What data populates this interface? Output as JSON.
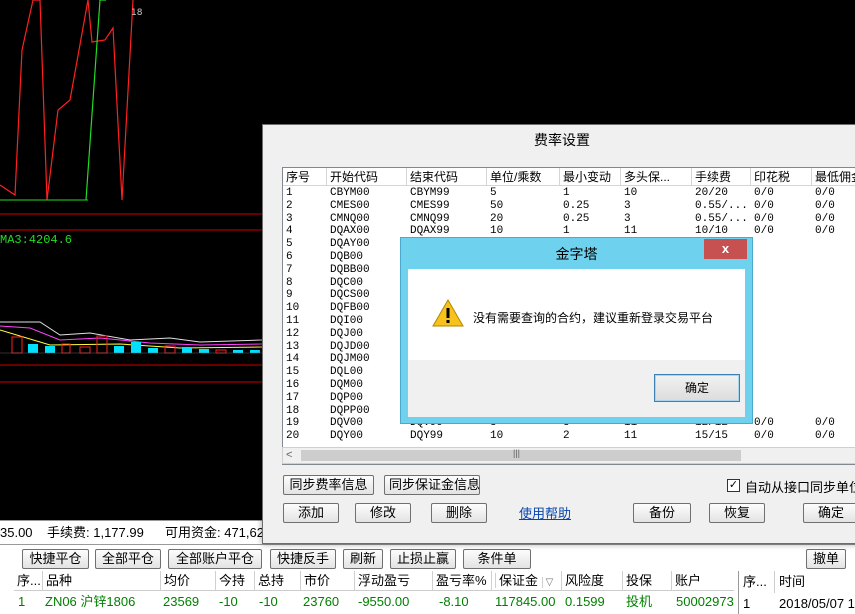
{
  "chart": {
    "ma_label": "MA3:4204.6",
    "tick_label": "18",
    "colors": {
      "red": "#ff2020",
      "green": "#22dd22",
      "cyan": "#00e0ff",
      "white": "#e0e0e0",
      "magenta": "#ff40ff"
    }
  },
  "status": {
    "balance_tail": "35.00",
    "fee": "手续费: 1,177.99",
    "available": "可用资金: 471,62"
  },
  "bottom_buttons": [
    "快捷平仓",
    "全部平仓",
    "全部账户平仓",
    "快捷反手",
    "刷新",
    "止损止赢",
    "条件单"
  ],
  "cancel_button": "撤单",
  "positions": {
    "headers": [
      "序...",
      "品种",
      "均价",
      "今持",
      "总持",
      "市价",
      "浮动盈亏",
      "盈亏率%",
      "保证金",
      "风险度",
      "投保",
      "账户"
    ],
    "sort_indicator": "▽",
    "rows": [
      [
        "1",
        "ZN06 沪锌1806",
        "23569",
        "-10",
        "-10",
        "23760",
        "-9550.00",
        "-8.10",
        "117845.00",
        "0.1599",
        "投机",
        "50002973"
      ]
    ]
  },
  "side_table": {
    "headers": [
      "序...",
      "时间"
    ],
    "row": [
      "1",
      "2018/05/07 1"
    ]
  },
  "fee_dialog": {
    "title": "费率设置",
    "columns": [
      "序号",
      "开始代码",
      "结束代码",
      "单位/乘数",
      "最小变动",
      "多头保...",
      "手续费",
      "印花税",
      "最低佣金"
    ],
    "rows": [
      [
        "1",
        "CBYM00",
        "CBYM99",
        "5",
        "1",
        "10",
        "20/20",
        "0/0",
        "0/0"
      ],
      [
        "2",
        "CMES00",
        "CMES99",
        "50",
        "0.25",
        "3",
        "0.55/...",
        "0/0",
        "0/0"
      ],
      [
        "3",
        "CMNQ00",
        "CMNQ99",
        "20",
        "0.25",
        "3",
        "0.55/...",
        "0/0",
        "0/0"
      ],
      [
        "4",
        "DQAX00",
        "DQAX99",
        "10",
        "1",
        "11",
        "10/10",
        "0/0",
        "0/0"
      ],
      [
        "5",
        "DQAY00",
        "",
        "",
        "",
        "",
        "",
        "",
        ""
      ],
      [
        "6",
        "DQB00",
        "",
        "",
        "",
        "",
        "",
        "",
        ""
      ],
      [
        "7",
        "DQBB00",
        "",
        "",
        "",
        "",
        "",
        "",
        ""
      ],
      [
        "8",
        "DQC00",
        "",
        "",
        "",
        "",
        "",
        "",
        ""
      ],
      [
        "9",
        "DQCS00",
        "",
        "",
        "",
        "",
        "",
        "",
        ""
      ],
      [
        "10",
        "DQFB00",
        "",
        "",
        "",
        "",
        "",
        "",
        ""
      ],
      [
        "11",
        "DQI00",
        "",
        "",
        "",
        "",
        "",
        "",
        ""
      ],
      [
        "12",
        "DQJ00",
        "",
        "",
        "",
        "",
        "",
        "",
        ""
      ],
      [
        "13",
        "DQJD00",
        "",
        "",
        "",
        "",
        "",
        "",
        ""
      ],
      [
        "14",
        "DQJM00",
        "",
        "",
        "",
        "",
        "",
        "",
        ""
      ],
      [
        "15",
        "DQL00",
        "",
        "",
        "",
        "",
        "",
        "",
        ""
      ],
      [
        "16",
        "DQM00",
        "",
        "",
        "",
        "",
        "",
        "",
        ""
      ],
      [
        "17",
        "DQP00",
        "",
        "",
        "",
        "",
        "",
        "",
        ""
      ],
      [
        "18",
        "DQPP00",
        "",
        "",
        "",
        "",
        "",
        "",
        ""
      ],
      [
        "19",
        "DQV00",
        "DQV99",
        "5",
        "5",
        "11",
        "12/12",
        "0/0",
        "0/0"
      ],
      [
        "20",
        "DQY00",
        "DQY99",
        "10",
        "2",
        "11",
        "15/15",
        "0/0",
        "0/0"
      ]
    ],
    "buttons": {
      "sync_rate": "同步费率信息",
      "sync_margin": "同步保证金信息",
      "add": "添加",
      "modify": "修改",
      "delete": "删除",
      "backup": "备份",
      "restore": "恢复",
      "confirm": "确定"
    },
    "help_link": "使用帮助",
    "auto_sync_label": "自动从接口同步单位",
    "auto_sync_checked": true
  },
  "alert": {
    "title": "金字塔",
    "close": "x",
    "message": "没有需要查询的合约，建议重新登录交易平台",
    "ok": "确定"
  }
}
